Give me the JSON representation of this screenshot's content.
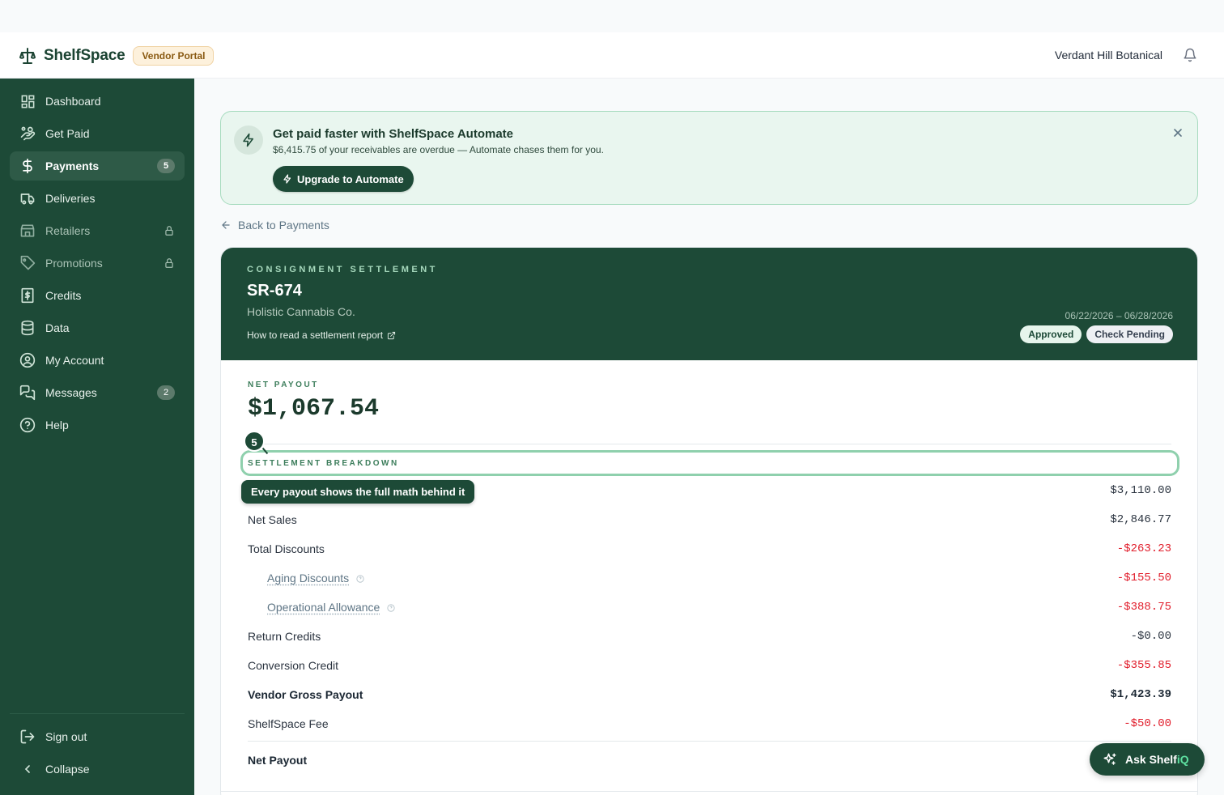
{
  "header": {
    "brand_name": "ShelfSpace",
    "portal_badge": "Vendor Portal",
    "account_name": "Verdant Hill Botanical"
  },
  "sidebar": {
    "items": [
      {
        "label": "Dashboard",
        "icon": "grid-icon"
      },
      {
        "label": "Get Paid",
        "icon": "hand-coins-icon"
      },
      {
        "label": "Payments",
        "icon": "dollar-icon",
        "badge": "5",
        "active": true
      },
      {
        "label": "Deliveries",
        "icon": "truck-icon"
      },
      {
        "label": "Retailers",
        "icon": "store-icon",
        "locked": true
      },
      {
        "label": "Promotions",
        "icon": "tag-icon",
        "locked": true
      },
      {
        "label": "Credits",
        "icon": "receipt-icon"
      },
      {
        "label": "Data",
        "icon": "database-icon"
      },
      {
        "label": "My Account",
        "icon": "user-circle-icon"
      },
      {
        "label": "Messages",
        "icon": "chat-icon",
        "badge": "2"
      },
      {
        "label": "Help",
        "icon": "help-circle-icon"
      }
    ],
    "sign_out": "Sign out",
    "collapse": "Collapse"
  },
  "promo": {
    "title": "Get paid faster with ShelfSpace Automate",
    "subtitle": "$6,415.75 of your receivables are overdue — Automate chases them for you.",
    "button": "Upgrade to Automate"
  },
  "back_link": "Back to Payments",
  "settlement": {
    "kicker": "CONSIGNMENT SETTLEMENT",
    "id": "SR-674",
    "retailer": "Holistic Cannabis Co.",
    "howto_link": "How to read a settlement report",
    "date_range": "06/22/2026 – 06/28/2026",
    "status_approved": "Approved",
    "status_check": "Check Pending",
    "net_payout_label": "NET PAYOUT",
    "net_payout_value": "$1,067.54",
    "breakdown_title": "SETTLEMENT BREAKDOWN",
    "step_number": "5",
    "tooltip": "Every payout shows the full math behind it",
    "rows": [
      {
        "label": "",
        "value": "$3,110.00"
      },
      {
        "label": "Net Sales",
        "value": "$2,846.77"
      },
      {
        "label": "Total Discounts",
        "value": "-$263.23"
      },
      {
        "label": "Aging Discounts",
        "value": "-$155.50"
      },
      {
        "label": "Operational Allowance",
        "value": "-$388.75"
      },
      {
        "label": "Return Credits",
        "value": "-$0.00"
      },
      {
        "label": "Conversion Credit",
        "value": "-$355.85"
      },
      {
        "label": "Vendor Gross Payout",
        "value": "$1,423.39"
      },
      {
        "label": "ShelfSpace Fee",
        "value": "-$50.00"
      },
      {
        "label": "Net Payout",
        "value": ""
      }
    ]
  },
  "fab": {
    "label_main": "Ask Shelf",
    "label_accent": "iQ"
  },
  "colors": {
    "brand_green": "#1d4a37",
    "negative_red": "#e11d2b",
    "promo_bg": "#e9f6ef"
  }
}
